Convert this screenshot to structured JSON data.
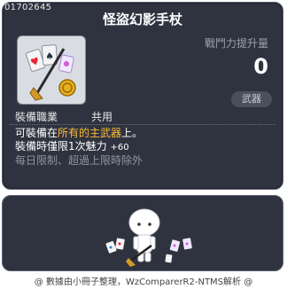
{
  "item": {
    "code": "01702645",
    "name": "怪盜幻影手杖",
    "stat_label": "戰鬥力提升量",
    "stat_value": "0",
    "type_badge": "武器",
    "job_label": "裝備職業",
    "job_value": "共用"
  },
  "description": {
    "line1_prefix": "可裝備在",
    "line1_highlight": "所有的主武器",
    "line1_suffix": "上。",
    "line2_text": "裝備時僅限1次魅力",
    "line2_bonus": "+60",
    "line3": "每日限制、超過上限時除外"
  },
  "footer": {
    "text": "@ 數據由小冊子整理，WzComparerR2-NTMS解析 @"
  },
  "colors": {
    "panel_bg": "#2f3340",
    "highlight": "#ffbb33",
    "muted": "#8f949e"
  },
  "icons": {
    "item": "phantom-cane-icon",
    "character": "character-preview"
  }
}
